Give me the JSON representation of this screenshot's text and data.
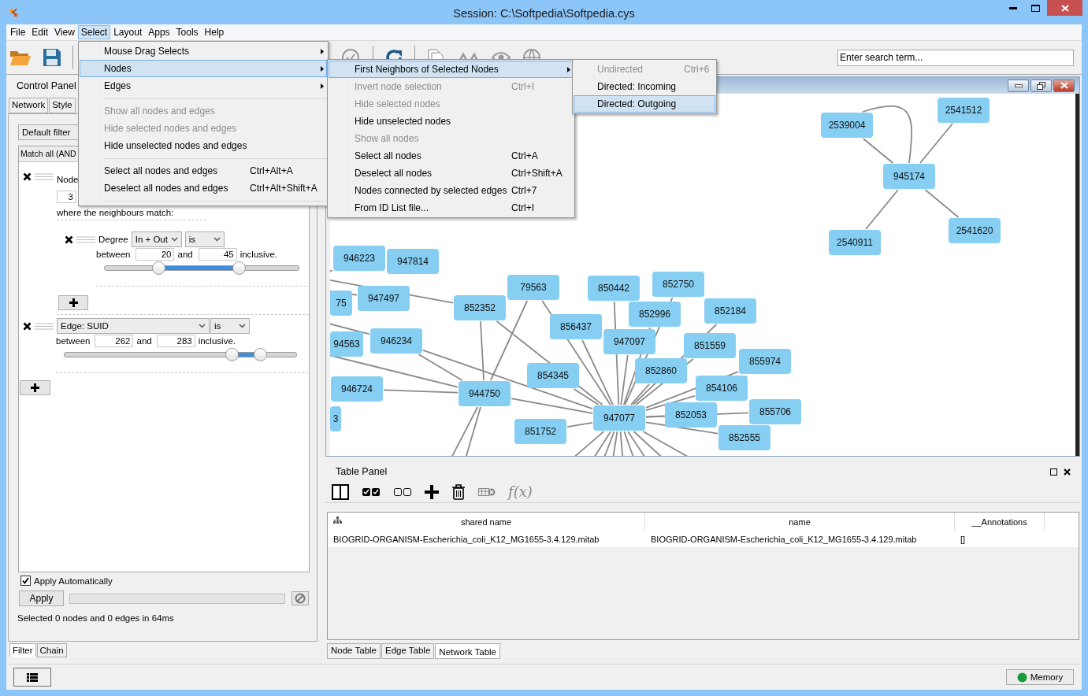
{
  "window": {
    "title": "Session: C:\\Softpedia\\Softpedia.cys"
  },
  "menu_bar": [
    {
      "label": "File",
      "selected": false
    },
    {
      "label": "Edit",
      "selected": false
    },
    {
      "label": "View",
      "selected": false
    },
    {
      "label": "Select",
      "selected": true
    },
    {
      "label": "Layout",
      "selected": false
    },
    {
      "label": "Apps",
      "selected": false
    },
    {
      "label": "Tools",
      "selected": false
    },
    {
      "label": "Help",
      "selected": false
    }
  ],
  "select_menu": {
    "items": [
      {
        "kind": "submenu",
        "label": "Mouse Drag Selects",
        "selected": false,
        "disabled": false
      },
      {
        "kind": "submenu",
        "label": "Nodes",
        "selected": true,
        "disabled": false
      },
      {
        "kind": "submenu",
        "label": "Edges",
        "selected": false,
        "disabled": false
      },
      {
        "kind": "separator"
      },
      {
        "kind": "item",
        "label": "Show all nodes and edges",
        "selected": false,
        "disabled": true
      },
      {
        "kind": "item",
        "label": "Hide selected nodes and edges",
        "selected": false,
        "disabled": true
      },
      {
        "kind": "item",
        "label": "Hide unselected nodes and edges",
        "selected": false,
        "disabled": false
      },
      {
        "kind": "separator"
      },
      {
        "kind": "item",
        "label": "Select all nodes and edges",
        "shortcut": "Ctrl+Alt+A",
        "selected": false,
        "disabled": false
      },
      {
        "kind": "item",
        "label": "Deselect all nodes and edges",
        "shortcut": "Ctrl+Alt+Shift+A",
        "selected": false,
        "disabled": false
      },
      {
        "kind": "separator"
      }
    ]
  },
  "nodes_submenu": {
    "items": [
      {
        "kind": "submenu",
        "label": "First Neighbors of Selected Nodes",
        "selected": true,
        "disabled": false
      },
      {
        "kind": "item",
        "label": "Invert node selection",
        "shortcut": "Ctrl+I",
        "selected": false,
        "disabled": true
      },
      {
        "kind": "item",
        "label": "Hide selected nodes",
        "selected": false,
        "disabled": true
      },
      {
        "kind": "item",
        "label": "Hide unselected nodes",
        "selected": false,
        "disabled": false
      },
      {
        "kind": "item",
        "label": "Show all nodes",
        "selected": false,
        "disabled": true
      },
      {
        "kind": "item",
        "label": "Select all nodes",
        "shortcut": "Ctrl+A",
        "selected": false,
        "disabled": false
      },
      {
        "kind": "item",
        "label": "Deselect all nodes",
        "shortcut": "Ctrl+Shift+A",
        "selected": false,
        "disabled": false
      },
      {
        "kind": "item",
        "label": "Nodes connected by selected edges",
        "shortcut": "Ctrl+7",
        "selected": false,
        "disabled": false
      },
      {
        "kind": "item",
        "label": "From ID List file...",
        "shortcut": "Ctrl+I",
        "selected": false,
        "disabled": false
      }
    ]
  },
  "neighbors_submenu": {
    "items": [
      {
        "kind": "item",
        "label": "Undirected",
        "shortcut": "Ctrl+6",
        "selected": false,
        "disabled": true
      },
      {
        "kind": "item",
        "label": "Directed: Incoming",
        "selected": false,
        "disabled": false
      },
      {
        "kind": "item",
        "label": "Directed: Outgoing",
        "selected": true,
        "disabled": false
      }
    ]
  },
  "toolbar": {
    "search": {
      "placeholder": "Enter search term..."
    }
  },
  "control_panel": {
    "title": "Control Panel",
    "tabs": [
      {
        "label": "Network",
        "selected": false
      },
      {
        "label": "Style",
        "selected": false
      }
    ],
    "filter_name": "Default filter",
    "match_mode": "Match all (AND",
    "node_filter": {
      "label": "Node",
      "distance": "3",
      "neighbour_text": "where the neighbours match:",
      "sub_filters": [
        {
          "attribute": "Degree",
          "type": "In + Out",
          "operator": "is",
          "between": "between",
          "low": "20",
          "and": "and",
          "high": "45",
          "inclusive": "inclusive.",
          "thumbs": [
            {
              "level": 0.28
            },
            {
              "level": 0.69
            }
          ]
        }
      ]
    },
    "filters": [
      {
        "attribute": "Edge: SUID",
        "operator": "is",
        "between": "between",
        "low": "262",
        "and": "and",
        "high": "283",
        "inclusive": "inclusive.",
        "thumbs": [
          {
            "level": 0.72
          },
          {
            "level": 0.84
          }
        ]
      }
    ],
    "apply_automatically": {
      "label": "Apply Automatically",
      "checked": true
    },
    "apply_button": "Apply",
    "progress": {
      "level": 0
    },
    "status": "Selected 0 nodes and 0 edges in 64ms",
    "bottom_tabs": [
      {
        "label": "Filter",
        "selected": true
      },
      {
        "label": "Chain",
        "selected": false
      }
    ]
  },
  "network_view": {
    "nodes": [
      {
        "label": "2539004"
      },
      {
        "label": "2541512"
      },
      {
        "label": "945174"
      },
      {
        "label": "2540911"
      },
      {
        "label": "2541620"
      },
      {
        "label": "946223"
      },
      {
        "label": "947814"
      },
      {
        "label": "75"
      },
      {
        "label": "947497"
      },
      {
        "label": "79563"
      },
      {
        "label": "852352"
      },
      {
        "label": "850442"
      },
      {
        "label": "852750"
      },
      {
        "label": "852184"
      },
      {
        "label": "852996"
      },
      {
        "label": "856437"
      },
      {
        "label": "947097"
      },
      {
        "label": "851559"
      },
      {
        "label": "852860"
      },
      {
        "label": "855974"
      },
      {
        "label": "94563"
      },
      {
        "label": "946234"
      },
      {
        "label": "854345"
      },
      {
        "label": "854106"
      },
      {
        "label": "946724"
      },
      {
        "label": "944750"
      },
      {
        "label": "947077"
      },
      {
        "label": "852053"
      },
      {
        "label": "855706"
      },
      {
        "label": "852555"
      },
      {
        "label": "851752"
      },
      {
        "label": "3"
      }
    ]
  },
  "table_panel": {
    "title": "Table Panel",
    "function_button": "f(x)",
    "columns": [
      "shared name",
      "name",
      "__Annotations"
    ],
    "rows": [
      [
        "BIOGRID-ORGANISM-Escherichia_coli_K12_MG1655-3.4.129.mitab",
        "BIOGRID-ORGANISM-Escherichia_coli_K12_MG1655-3.4.129.mitab",
        "[]"
      ]
    ],
    "tabs": [
      {
        "label": "Node Table",
        "selected": false
      },
      {
        "label": "Edge Table",
        "selected": false
      },
      {
        "label": "Network Table",
        "selected": true
      }
    ]
  },
  "status_bar": {
    "memory_button": "Memory"
  }
}
